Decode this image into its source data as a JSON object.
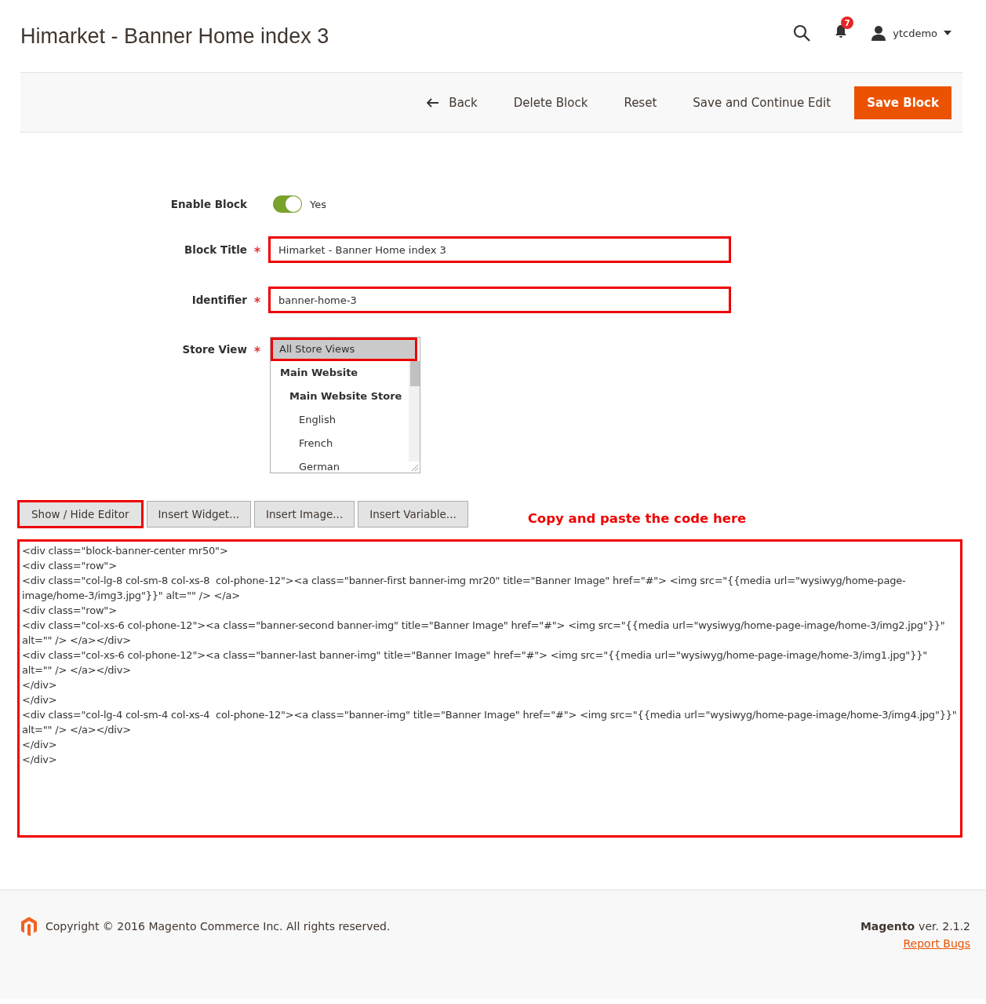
{
  "header": {
    "title": "Himarket - Banner Home index 3",
    "notifications": "7",
    "user": "ytcdemo"
  },
  "actions": [
    {
      "label": "Back",
      "kind": "back"
    },
    {
      "label": "Delete Block",
      "kind": "plain"
    },
    {
      "label": "Reset",
      "kind": "plain"
    },
    {
      "label": "Save and Continue Edit",
      "kind": "plain"
    },
    {
      "label": "Save Block",
      "kind": "primary"
    }
  ],
  "form": {
    "enable": {
      "label": "Enable Block",
      "on": true,
      "value": "Yes"
    },
    "title": {
      "label": "Block Title",
      "required": true,
      "value": "Himarket - Banner Home index 3",
      "highlighted": true
    },
    "identifier": {
      "label": "Identifier",
      "required": true,
      "value": "banner-home-3",
      "highlighted": true
    },
    "store_view": {
      "label": "Store View",
      "required": true,
      "options": [
        {
          "label": "All Store Views",
          "selected": true,
          "highlighted": true
        },
        {
          "label": "Main Website",
          "selected": false,
          "children": [
            {
              "label": "Main Website Store",
              "selected": false,
              "children": [
                {
                  "label": "English",
                  "selected": false
                },
                {
                  "label": "French",
                  "selected": false
                },
                {
                  "label": "German",
                  "selected": false
                }
              ]
            }
          ]
        }
      ]
    }
  },
  "editor_buttons": [
    {
      "label": "Show / Hide Editor",
      "highlighted": true
    },
    {
      "label": "Insert Widget...",
      "highlighted": false
    },
    {
      "label": "Insert Image...",
      "highlighted": false
    },
    {
      "label": "Insert Variable...",
      "highlighted": false
    }
  ],
  "annotation": "Copy and paste the code here",
  "content": {
    "highlighted": true,
    "value": "<div class=\"block-banner-center mr50\">\n<div class=\"row\">\n<div class=\"col-lg-8 col-sm-8 col-xs-8  col-phone-12\"><a class=\"banner-first banner-img mr20\" title=\"Banner Image\" href=\"#\"> <img src=\"{{media url=\"wysiwyg/home-page-image/home-3/img3.jpg\"}}\" alt=\"\" /> </a>\n<div class=\"row\">\n<div class=\"col-xs-6 col-phone-12\"><a class=\"banner-second banner-img\" title=\"Banner Image\" href=\"#\"> <img src=\"{{media url=\"wysiwyg/home-page-image/home-3/img2.jpg\"}}\" alt=\"\" /> </a></div>\n<div class=\"col-xs-6 col-phone-12\"><a class=\"banner-last banner-img\" title=\"Banner Image\" href=\"#\"> <img src=\"{{media url=\"wysiwyg/home-page-image/home-3/img1.jpg\"}}\" alt=\"\" /> </a></div>\n</div>\n</div>\n<div class=\"col-lg-4 col-sm-4 col-xs-4  col-phone-12\"><a class=\"banner-img\" title=\"Banner Image\" href=\"#\"> <img src=\"{{media url=\"wysiwyg/home-page-image/home-3/img4.jpg\"}}\" alt=\"\" /> </a></div>\n</div>\n</div>"
  },
  "footer": {
    "copyright": "Copyright © 2016 Magento Commerce Inc. All rights reserved.",
    "brand": "Magento",
    "version": "ver. 2.1.2",
    "link": "Report Bugs"
  }
}
